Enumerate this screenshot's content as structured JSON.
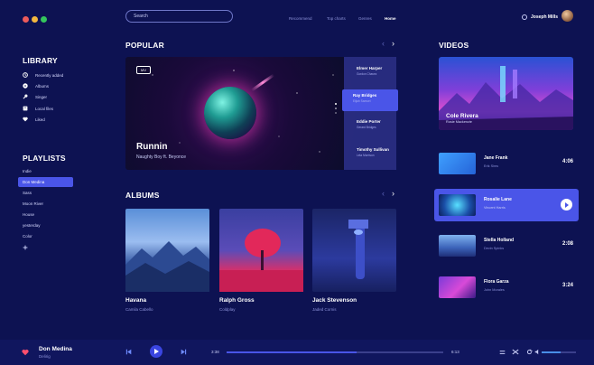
{
  "header": {
    "search_placeholder": "Search",
    "nav": [
      "Recommend",
      "Top charts",
      "Genres",
      "Home"
    ],
    "active_nav": "Home",
    "user_name": "Joseph Mills"
  },
  "library": {
    "title": "LIBRARY",
    "items": [
      {
        "label": "Recently added",
        "icon": "clock-icon"
      },
      {
        "label": "Albums",
        "icon": "disc-icon"
      },
      {
        "label": "Singer",
        "icon": "mic-icon"
      },
      {
        "label": "Local files",
        "icon": "folder-icon"
      },
      {
        "label": "Liked",
        "icon": "heart-icon"
      }
    ]
  },
  "playlists": {
    "title": "PLAYLISTS",
    "items": [
      "Indie",
      "Don Medina",
      "Sass",
      "Moon River",
      "House",
      "yesterday",
      "Color"
    ],
    "active": "Don Medina"
  },
  "popular": {
    "title": "POPULAR",
    "badge": "MV",
    "featured_title": "Runnin",
    "featured_artist": "Naughty Boy ft. Beyonce",
    "tracks": [
      {
        "name": "Elmer Harper",
        "artist": "Gordon Chavez"
      },
      {
        "name": "Ray Bridges",
        "artist": "Elijah Samuel"
      },
      {
        "name": "Eddie Porter",
        "artist": "Gerard Bridges"
      },
      {
        "name": "Timothy Sullivan",
        "artist": "Leta Morrison"
      }
    ],
    "active_track": 1
  },
  "albums": {
    "title": "ALBUMS",
    "items": [
      {
        "name": "Havana",
        "artist": "Camila Cabello"
      },
      {
        "name": "Ralph Gross",
        "artist": "Coldplay"
      },
      {
        "name": "Jack Stevenson",
        "artist": "Jaded Cornis"
      }
    ]
  },
  "videos": {
    "title": "VIDEOS",
    "featured_name": "Cole Rivera",
    "featured_artist": "Rosie Mackenzie",
    "items": [
      {
        "name": "Jane Frank",
        "artist": "Erik Sims",
        "duration": "4:06"
      },
      {
        "name": "Rosalie Lane",
        "artist": "Vincent Harris",
        "duration": ""
      },
      {
        "name": "Stella Holland",
        "artist": "Devin Spinks",
        "duration": "2:08"
      },
      {
        "name": "Flora Garza",
        "artist": "John Morales",
        "duration": "3:24"
      }
    ],
    "active": 1
  },
  "player": {
    "now_playing_title": "Don Medina",
    "now_playing_artist": "Delirig",
    "elapsed": "3:38",
    "total": "6:13",
    "progress": 0.6,
    "volume": 0.55
  },
  "colors": {
    "background": "#0d1252",
    "accent": "#4a55e8",
    "window_red": "#ec5b5b",
    "window_yellow": "#f3b73f",
    "window_green": "#34c65d",
    "heart": "#ff4f6e"
  }
}
